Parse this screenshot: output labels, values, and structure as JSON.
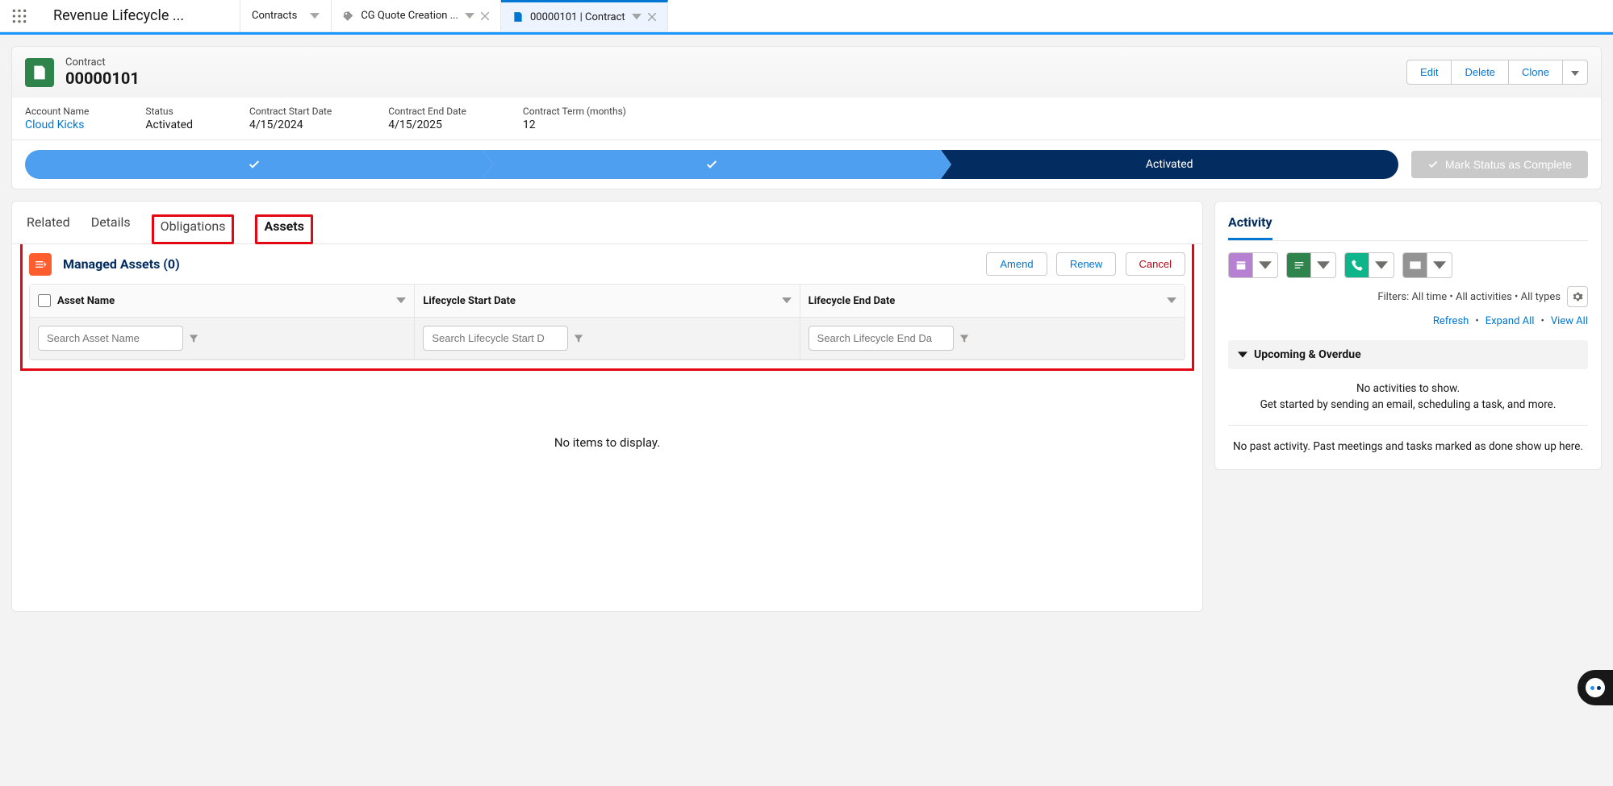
{
  "topTabs": {
    "appName": "Revenue Lifecycle ...",
    "objectTab": "Contracts",
    "quoteTab": "CG Quote Creation ...",
    "contractTab": "00000101 | Contract"
  },
  "recordHeader": {
    "objectLabel": "Contract",
    "recordNumber": "00000101",
    "actions": {
      "edit": "Edit",
      "delete": "Delete",
      "clone": "Clone"
    }
  },
  "highlights": {
    "accountLabel": "Account Name",
    "accountValue": "Cloud Kicks",
    "statusLabel": "Status",
    "statusValue": "Activated",
    "startLabel": "Contract Start Date",
    "startValue": "4/15/2024",
    "endLabel": "Contract End Date",
    "endValue": "4/15/2025",
    "termLabel": "Contract Term (months)",
    "termValue": "12"
  },
  "path": {
    "currentLabel": "Activated",
    "completeBtn": "Mark Status as Complete"
  },
  "mainTabs": {
    "related": "Related",
    "details": "Details",
    "obligations": "Obligations",
    "assets": "Assets"
  },
  "managedAssets": {
    "title": "Managed Assets (0)",
    "amend": "Amend",
    "renew": "Renew",
    "cancel": "Cancel",
    "cols": {
      "name": "Asset Name",
      "start": "Lifecycle Start Date",
      "end": "Lifecycle End Date"
    },
    "placeholders": {
      "name": "Search Asset Name",
      "start": "Search Lifecycle Start D",
      "end": "Search Lifecycle End Da"
    },
    "empty": "No items to display."
  },
  "activity": {
    "tab": "Activity",
    "filters": "Filters: All time  •  All activities  •  All types",
    "refresh": "Refresh",
    "expand": "Expand All",
    "view": "View All",
    "upcoming": "Upcoming & Overdue",
    "noActLine1": "No activities to show.",
    "noActLine2": "Get started by sending an email, scheduling a task, and more.",
    "pastText": "No past activity. Past meetings and tasks marked as done show up here."
  }
}
